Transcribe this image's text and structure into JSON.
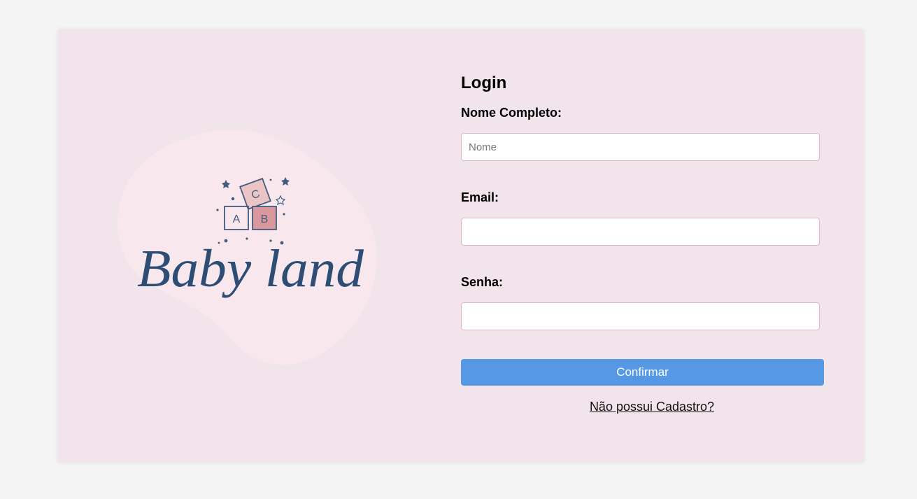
{
  "brand": {
    "name": "Baby land",
    "blocks": [
      "A",
      "B",
      "C"
    ]
  },
  "form": {
    "title": "Login",
    "name_label": "Nome Completo:",
    "name_value": "",
    "name_placeholder": "Nome",
    "email_label": "Email:",
    "email_value": "",
    "email_placeholder": "",
    "password_label": "Senha:",
    "password_value": "",
    "password_placeholder": "",
    "submit_label": "Confirmar",
    "register_link": "Não possui Cadastro?"
  },
  "colors": {
    "page_background": "#f4f4f4",
    "card_background": "#f2e4eb",
    "logo_blob": "#f8e8ed",
    "brand_text": "#2d4d74",
    "block_c": "#ebc4c6",
    "block_b": "#d9979e",
    "button": "#5698e3",
    "input_border": "#e2b6c8"
  }
}
